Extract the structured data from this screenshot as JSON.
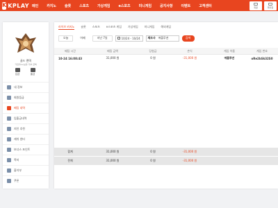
{
  "brand": {
    "name": "KPLAY",
    "mark": "K",
    "accent": "#e8451f"
  },
  "nav": [
    "메인",
    "카지노",
    "슬롯",
    "스포츠",
    "가상게임",
    "e스포츠",
    "미니게임",
    "공지사항",
    "이벤트",
    "고객센터"
  ],
  "top_icons": [
    {
      "icon": "user-icon",
      "label": "회원"
    },
    {
      "icon": "mail-icon",
      "label": "쪽지함"
    }
  ],
  "sidebar": {
    "user_name": "골드 랜덱",
    "user_sub": "가입자Lv/보유 기부 금액",
    "buttons": [
      {
        "icon": "deposit-icon",
        "label": "입금"
      },
      {
        "icon": "withdraw-icon",
        "label": "출금"
      }
    ],
    "menu": [
      {
        "label": "내 정보",
        "active": false
      },
      {
        "label": "회원등급",
        "active": false
      },
      {
        "label": "베팅 내역",
        "active": true
      },
      {
        "label": "입출금내역",
        "active": false
      },
      {
        "label": "지인 추천",
        "active": false
      },
      {
        "label": "캐쉬 센터",
        "active": false
      },
      {
        "label": "보너스 포인트",
        "active": false
      },
      {
        "label": "쪽지",
        "active": false
      },
      {
        "label": "출석부",
        "active": false
      },
      {
        "label": "쿠폰",
        "active": false
      }
    ]
  },
  "tabs": [
    "라이브 카지노",
    "슬롯",
    "스포츠",
    "e스포츠 게임",
    "가상게임",
    "미니게임",
    "해외게임"
  ],
  "filter": {
    "today": "오늘",
    "yesterday": "어제",
    "last7": "지난 7일",
    "date_range": "10/24 - 10/24",
    "category_label": "제조사",
    "category_value": "에볼루션",
    "search": "검색"
  },
  "table": {
    "headers": [
      "베팅 시간",
      "베팅 금액",
      "당첨금",
      "손익",
      "게임 이름",
      "게임 번호"
    ],
    "rows": [
      [
        "10-24 16:08:43",
        "31,000 원",
        "0 원",
        "-31,000 원",
        "에볼루션",
        "oRe2bSk32S0"
      ]
    ]
  },
  "summary": [
    {
      "label": "합계",
      "bet": "31,000 원",
      "win": "0 원",
      "pnl": "-31,000 원"
    },
    {
      "label": "전체",
      "bet": "31,000 원",
      "win": "0 원",
      "pnl": "-31,000 원"
    }
  ]
}
